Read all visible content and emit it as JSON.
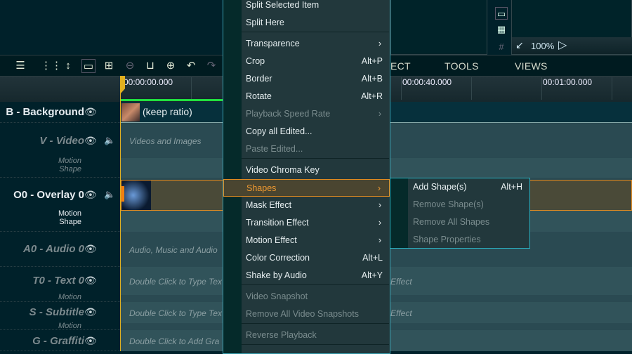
{
  "preview": {
    "zoom": "100%"
  },
  "menubar": {
    "tabs": [
      "ECT",
      "TOOLS",
      "VIEWS"
    ]
  },
  "ruler": {
    "timecodes": [
      "00:00:00.000",
      "00:00:40.000",
      "00:01:00.000"
    ]
  },
  "tracks": [
    {
      "label": "B - Background",
      "sub": "",
      "placeholder": "",
      "clip_text": "(keep ratio)"
    },
    {
      "label": "V - Video",
      "sub": "Motion\nShape",
      "placeholder": "Videos and Images"
    },
    {
      "label": "O0 - Overlay 0",
      "sub": "Motion\nShape"
    },
    {
      "label": "A0 - Audio 0",
      "placeholder": "Audio, Music and Audio"
    },
    {
      "label": "T0 - Text 0",
      "sub": "Motion",
      "placeholder": "Double Click to Type Tex",
      "effect": "Effect"
    },
    {
      "label": "S - Subtitle",
      "sub": "Motion",
      "placeholder": "Double Click to Type Tex",
      "effect": "Effect"
    },
    {
      "label": "G - Graffiti",
      "placeholder": "Double Click to Add Gra"
    }
  ],
  "context_menu": {
    "items": [
      {
        "label": "Split Selected Item"
      },
      {
        "label": "Split Here"
      },
      {
        "label": "Transparence",
        "submenu": true
      },
      {
        "label": "Crop",
        "shortcut": "Alt+P"
      },
      {
        "label": "Border",
        "shortcut": "Alt+B"
      },
      {
        "label": "Rotate",
        "shortcut": "Alt+R"
      },
      {
        "label": "Playback Speed Rate",
        "submenu": true,
        "disabled": true
      },
      {
        "label": "Copy all Edited..."
      },
      {
        "label": "Paste Edited...",
        "disabled": true
      },
      {
        "label": "Video Chroma Key"
      },
      {
        "label": "Shapes",
        "submenu": true,
        "highlighted": true
      },
      {
        "label": "Mask Effect",
        "submenu": true
      },
      {
        "label": "Transition Effect",
        "submenu": true
      },
      {
        "label": "Motion Effect",
        "submenu": true
      },
      {
        "label": "Color Correction",
        "shortcut": "Alt+L"
      },
      {
        "label": "Shake by Audio",
        "shortcut": "Alt+Y"
      },
      {
        "label": "Video Snapshot",
        "disabled": true
      },
      {
        "label": "Remove All Video Snapshots",
        "disabled": true
      },
      {
        "label": "Reverse Playback",
        "disabled": true
      }
    ]
  },
  "shapes_submenu": {
    "items": [
      {
        "label": "Add Shape(s)",
        "shortcut": "Alt+H"
      },
      {
        "label": "Remove Shape(s)",
        "disabled": true
      },
      {
        "label": "Remove All Shapes",
        "disabled": true
      },
      {
        "label": "Shape Properties",
        "disabled": true
      }
    ]
  },
  "colors": {
    "accent": "#e08a20",
    "menu_border": "#3aa0b0",
    "playhead": "#e0b020",
    "progress": "#20e040"
  }
}
